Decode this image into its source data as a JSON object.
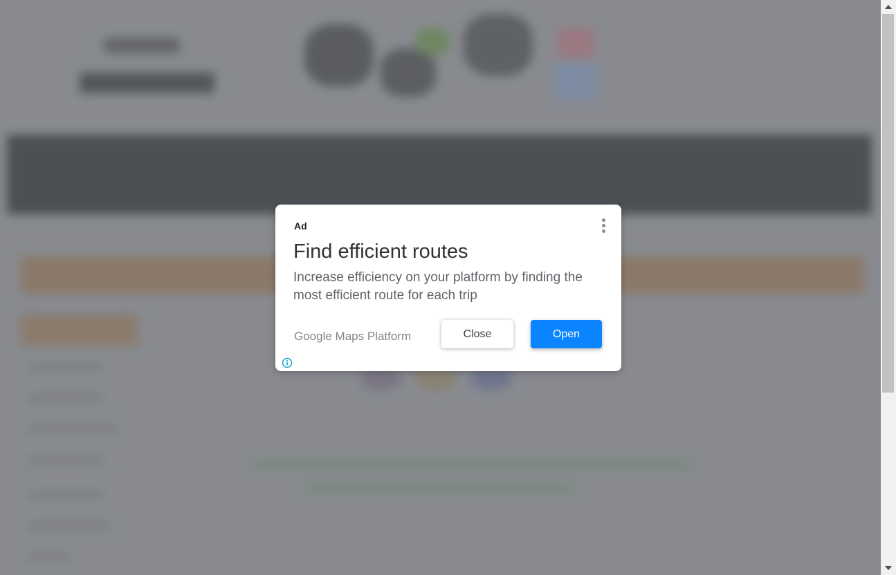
{
  "ad": {
    "badge": "Ad",
    "title": "Find efficient routes",
    "body": "Increase efficiency on your platform by finding the most efficient route for each trip",
    "advertiser": "Google Maps Platform",
    "close_label": "Close",
    "open_label": "Open",
    "menu_icon": "kebab-menu-icon",
    "info_icon": "info-icon"
  },
  "colors": {
    "open_button": "#0a84ff",
    "page_dim": "#8b8e93",
    "info_icon": "#1aa3c8"
  },
  "scrollbar": {
    "up_icon": "arrow-up-icon",
    "down_icon": "arrow-down-icon"
  }
}
